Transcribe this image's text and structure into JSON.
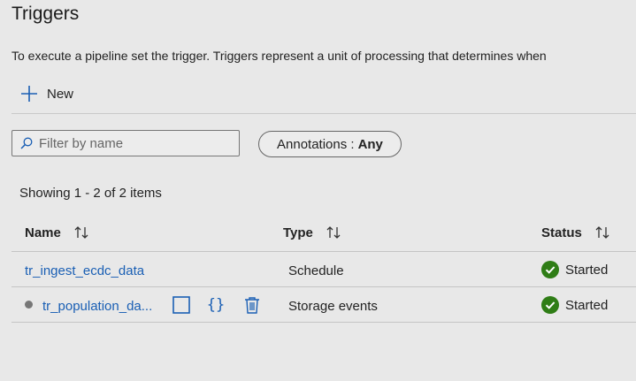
{
  "page": {
    "title": "Triggers",
    "description": "To execute a pipeline set the trigger. Triggers represent a unit of processing that determines when"
  },
  "toolbar": {
    "new_label": "New"
  },
  "filter": {
    "placeholder": "Filter by name",
    "value": ""
  },
  "annotations": {
    "label": "Annotations :",
    "value": "Any"
  },
  "summary": "Showing 1 - 2 of 2 items",
  "table": {
    "columns": [
      "Name",
      "Type",
      "Status"
    ],
    "rows": [
      {
        "name": "tr_ingest_ecdc_data",
        "type": "Schedule",
        "status": "Started"
      },
      {
        "name": "tr_population_da...",
        "type": "Storage events",
        "status": "Started"
      }
    ]
  },
  "icons": {
    "new": "plus-icon",
    "filter": "search-icon",
    "sort": "sort-arrows-icon",
    "status": "check-circle-icon",
    "row_actions": [
      "checkbox-icon",
      "code-braces-icon",
      "trash-icon"
    ]
  },
  "colors": {
    "link": "#1a5fb4",
    "status_ok": "#2f7d16",
    "background": "#e8e8e8"
  }
}
